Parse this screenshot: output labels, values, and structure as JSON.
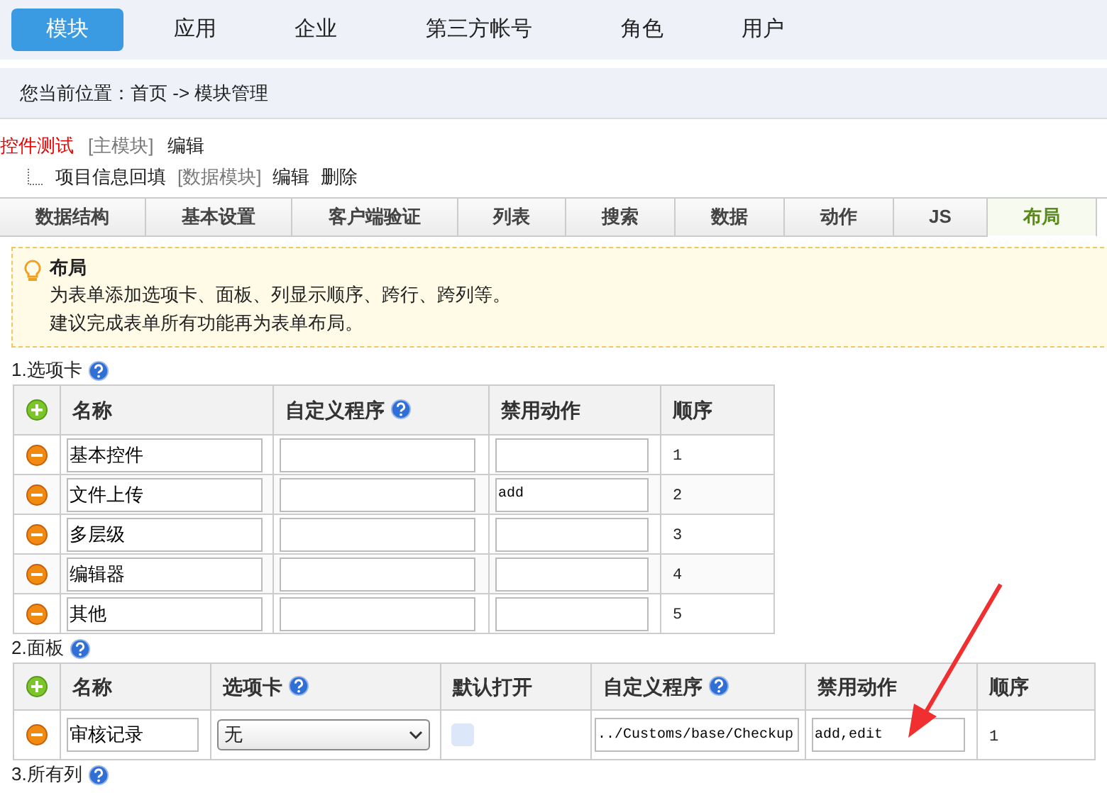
{
  "nav": [
    {
      "label": "模块",
      "selected": true
    },
    {
      "label": "应用",
      "selected": false
    },
    {
      "label": "企业",
      "selected": false
    },
    {
      "label": "第三方帐号",
      "selected": false
    },
    {
      "label": "角色",
      "selected": false
    },
    {
      "label": "用户",
      "selected": false
    }
  ],
  "breadcrumb": "您当前位置：首页 -> 模块管理",
  "tree": {
    "name": "控件测试",
    "tag": "[主模块]",
    "actions": [
      "编辑"
    ],
    "children": [
      {
        "name": "项目信息回填",
        "tag": "[数据模块]",
        "actions": [
          "编辑",
          "删除"
        ]
      }
    ]
  },
  "tabs": [
    {
      "label": "数据结构",
      "selected": false
    },
    {
      "label": "基本设置",
      "selected": false
    },
    {
      "label": "客户端验证",
      "selected": false
    },
    {
      "label": "列表",
      "selected": false
    },
    {
      "label": "搜索",
      "selected": false
    },
    {
      "label": "数据",
      "selected": false
    },
    {
      "label": "动作",
      "selected": false
    },
    {
      "label": "JS",
      "selected": false
    },
    {
      "label": "布局",
      "selected": true
    }
  ],
  "tip": {
    "title": "布局",
    "lines": [
      "为表单添加选项卡、面板、列显示顺序、跨行、跨列等。",
      "建议完成表单所有功能再为表单布局。"
    ]
  },
  "section1": {
    "title": "1.选项卡",
    "columns": [
      "名称",
      "自定义程序",
      "禁用动作",
      "顺序"
    ],
    "rows": [
      {
        "name": "基本控件",
        "program": "",
        "disabled_actions": "",
        "order": "1"
      },
      {
        "name": "文件上传",
        "program": "",
        "disabled_actions": "add",
        "order": "2"
      },
      {
        "name": "多层级",
        "program": "",
        "disabled_actions": "",
        "order": "3"
      },
      {
        "name": "编辑器",
        "program": "",
        "disabled_actions": "",
        "order": "4"
      },
      {
        "name": "其他",
        "program": "",
        "disabled_actions": "",
        "order": "5"
      }
    ]
  },
  "section2": {
    "title": "2.面板",
    "columns": [
      "名称",
      "选项卡",
      "默认打开",
      "自定义程序",
      "禁用动作",
      "顺序"
    ],
    "rows": [
      {
        "name": "审核记录",
        "tab": "无",
        "default_open": false,
        "program": "../Customs/base/Checkup",
        "disabled_actions": "add,edit",
        "order": "1"
      }
    ]
  },
  "section3": {
    "title": "3.所有列"
  }
}
